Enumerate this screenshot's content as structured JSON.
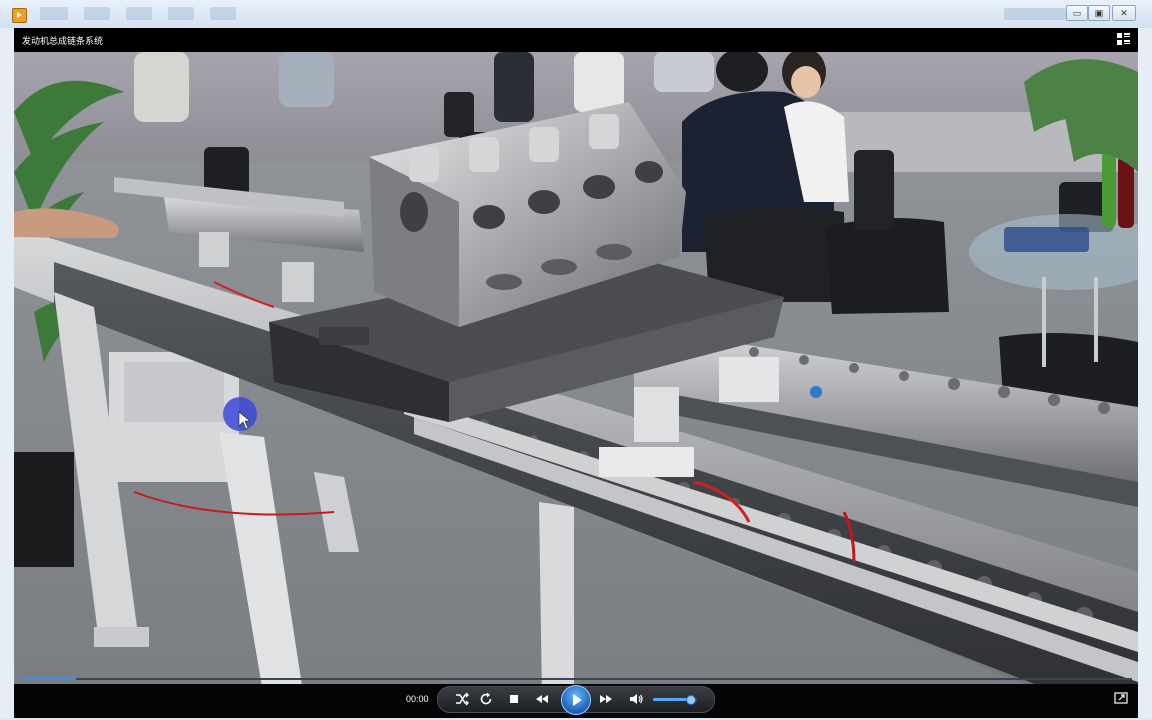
{
  "window": {
    "minimize_label": "▭",
    "maximize_label": "▣",
    "close_label": "✕"
  },
  "player": {
    "video_title": "发动机总成链条系统",
    "time": "00:00",
    "progress_fraction": 0.05,
    "volume_fraction": 0.85,
    "accent_color": "#3e8fe6"
  },
  "icons": {
    "app": "player-app-icon",
    "playlist": "playlist-icon",
    "shuffle": "shuffle-icon",
    "repeat": "repeat-icon",
    "stop": "stop-icon",
    "rewind": "rewind-icon",
    "play": "play-icon",
    "fast_forward": "fast-forward-icon",
    "volume": "volume-icon",
    "fullscreen": "fullscreen-icon"
  }
}
